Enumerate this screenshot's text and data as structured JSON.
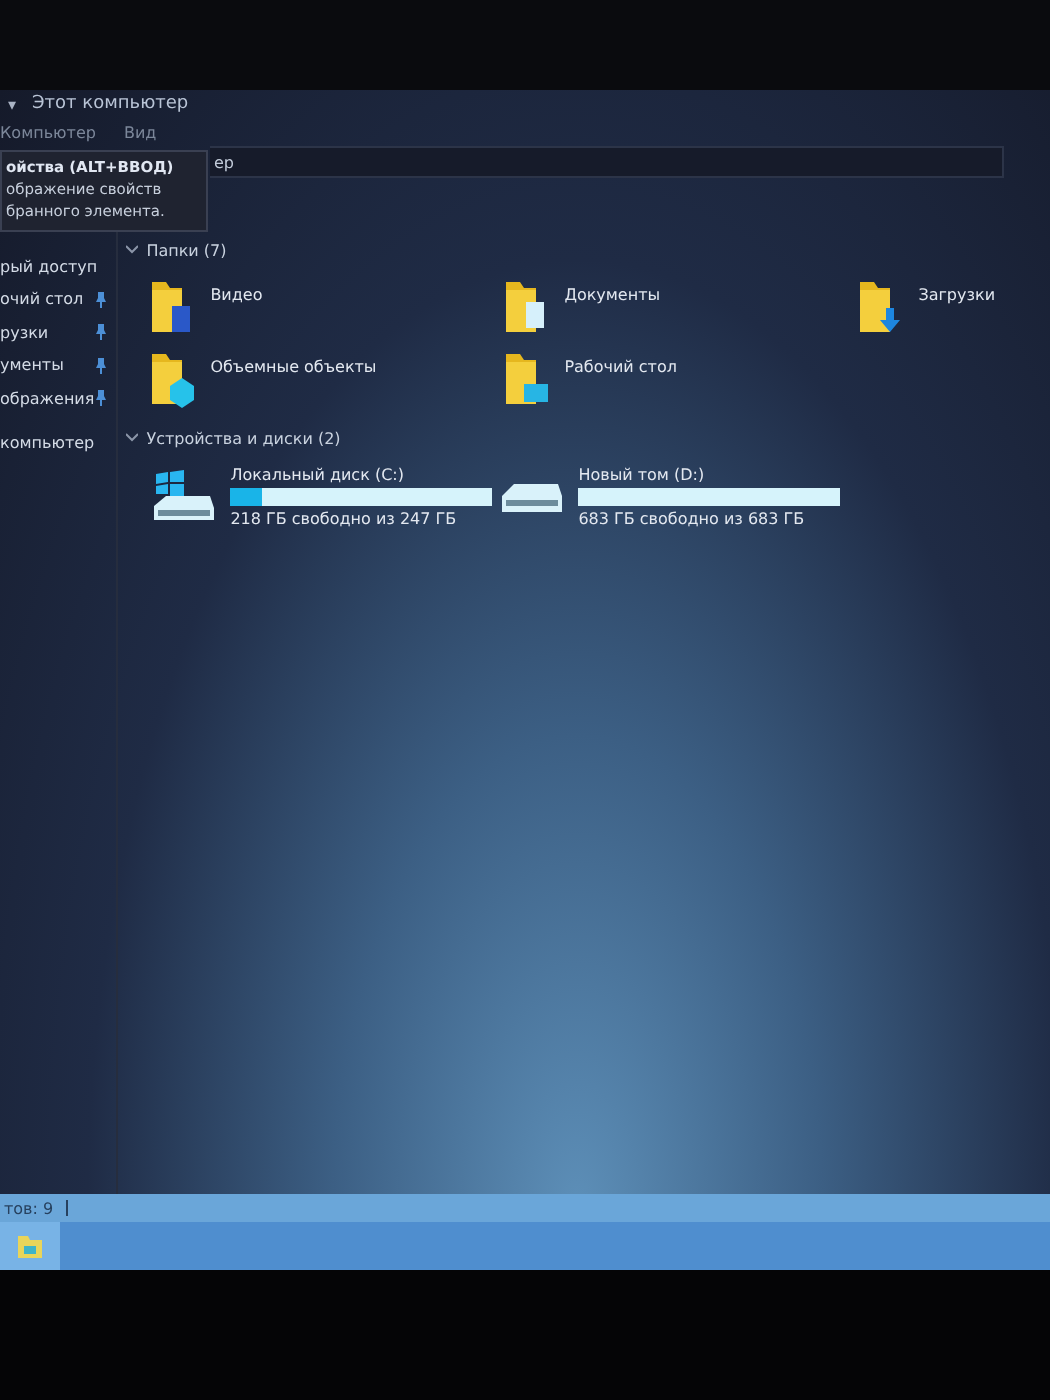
{
  "window": {
    "title": "Этот компьютер",
    "caret": "▾"
  },
  "ribbon_tabs": [
    {
      "label": "Компьютер"
    },
    {
      "label": "Вид"
    }
  ],
  "tooltip": {
    "title": "ойства (ALT+ВВОД)",
    "lines": [
      "ображение свойств",
      "бранного элемента."
    ]
  },
  "address": {
    "text": "ер"
  },
  "sidebar": {
    "items": [
      {
        "label": "рый доступ",
        "pinned": false
      },
      {
        "label": "очий стол",
        "pinned": true
      },
      {
        "label": "рузки",
        "pinned": true
      },
      {
        "label": "ументы",
        "pinned": true
      },
      {
        "label": "ображения",
        "pinned": true
      },
      {
        "label": "компьютер",
        "pinned": false
      }
    ]
  },
  "groups": [
    {
      "title": "Папки (7)",
      "expanded": true,
      "kind": "folders",
      "items": [
        {
          "name": "Видео",
          "kind": "video"
        },
        {
          "name": "Документы",
          "kind": "documents"
        },
        {
          "name": "Загрузки",
          "kind": "downloads"
        },
        {
          "name": "Объемные объекты",
          "kind": "objects3d"
        },
        {
          "name": "Рабочий стол",
          "kind": "desktop"
        }
      ]
    },
    {
      "title": "Устройства и диски (2)",
      "expanded": true,
      "kind": "drives",
      "items": [
        {
          "name": "Локальный диск (C:)",
          "free": "218 ГБ свободно из 247 ГБ",
          "level": 0.12,
          "kind": "system"
        },
        {
          "name": "Новый том (D:)",
          "free": "683 ГБ свободно из 683 ГБ",
          "level": 0,
          "kind": "plain"
        }
      ]
    }
  ],
  "status_bar": {
    "text": "тов: 9"
  }
}
